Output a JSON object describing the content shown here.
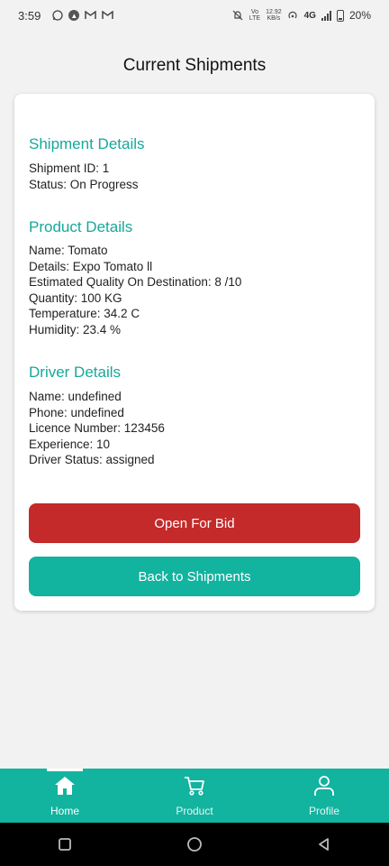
{
  "status_bar": {
    "time": "3:59",
    "net_speed_top": "12.92",
    "net_speed_bottom": "KB/s",
    "volte_top": "Vo",
    "volte_bottom": "LTE",
    "network": "4G",
    "battery": "20%"
  },
  "header": {
    "title": "Current Shipments"
  },
  "shipment": {
    "title": "Shipment Details",
    "lines": [
      "Shipment ID: 1",
      "Status: On Progress"
    ]
  },
  "product": {
    "title": "Product Details",
    "lines": [
      "Name: Tomato",
      "Details: Expo Tomato ll",
      "Estimated Quality On Destination: 8 /10",
      "Quantity: 100 KG",
      "Temperature: 34.2 C",
      "Humidity: 23.4 %"
    ]
  },
  "driver": {
    "title": "Driver Details",
    "lines": [
      "Name: undefined",
      "Phone: undefined",
      "Licence Number: 123456",
      "Experience: 10",
      "Driver Status: assigned"
    ]
  },
  "actions": {
    "open_bid": "Open For Bid",
    "back": "Back to Shipments"
  },
  "tabs": [
    {
      "label": "Home",
      "icon": "home-icon",
      "active": true
    },
    {
      "label": "Product",
      "icon": "cart-icon",
      "active": false
    },
    {
      "label": "Profile",
      "icon": "person-icon",
      "active": false
    }
  ],
  "colors": {
    "accent": "#12b39f",
    "section_title": "#17a89a",
    "danger": "#c42a2a"
  }
}
